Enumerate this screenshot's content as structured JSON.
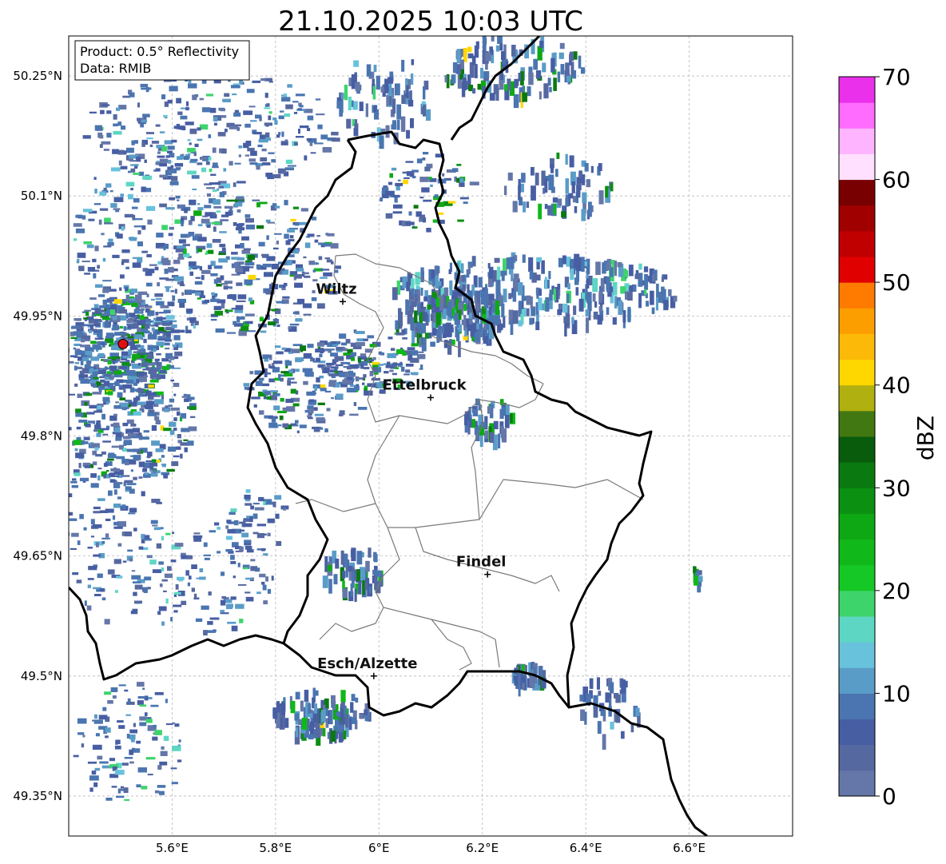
{
  "title": "21.10.2025 10:03 UTC",
  "info": {
    "product": "Product: 0.5° Reflectivity",
    "data": "Data: RMIB"
  },
  "lat_labels": [
    "50.25°N",
    "50.1°N",
    "49.95°N",
    "49.8°N",
    "49.65°N",
    "49.5°N",
    "49.35°N"
  ],
  "lon_labels": [
    "5.6°E",
    "5.8°E",
    "6°E",
    "6.2°E",
    "6.4°E",
    "6.6°E"
  ],
  "map_extent": {
    "lon": [
      5.4,
      6.8
    ],
    "lat": [
      49.3,
      50.3
    ]
  },
  "colorbar": {
    "label": "dBZ",
    "ticks": [
      "0",
      "10",
      "20",
      "30",
      "40",
      "50",
      "60",
      "70"
    ],
    "range": [
      0,
      70
    ],
    "colors": [
      "#6577a8",
      "#5568a0",
      "#475ea3",
      "#4a75b0",
      "#5a9cc8",
      "#68c2dc",
      "#5ed6c4",
      "#3ed46c",
      "#15c826",
      "#10b81a",
      "#0ea814",
      "#0c9012",
      "#0a7a10",
      "#085c0c",
      "#427812",
      "#b0b010",
      "#ffd700",
      "#fcb908",
      "#fd9e00",
      "#ff7b00",
      "#e10000",
      "#c00000",
      "#a10000",
      "#780000",
      "#ffe0ff",
      "#ffb4ff",
      "#ff6cff",
      "#ea30ea"
    ]
  },
  "cities": [
    {
      "name": "Wiltz",
      "lon": 5.93,
      "lat": 49.968
    },
    {
      "name": "Ettelbruck",
      "lon": 6.1,
      "lat": 49.848
    },
    {
      "name": "Findel",
      "lon": 6.21,
      "lat": 49.627
    },
    {
      "name": "Esch/Alzette",
      "lon": 5.99,
      "lat": 49.5
    }
  ],
  "radar_site": {
    "lon": 5.505,
    "lat": 49.915
  }
}
